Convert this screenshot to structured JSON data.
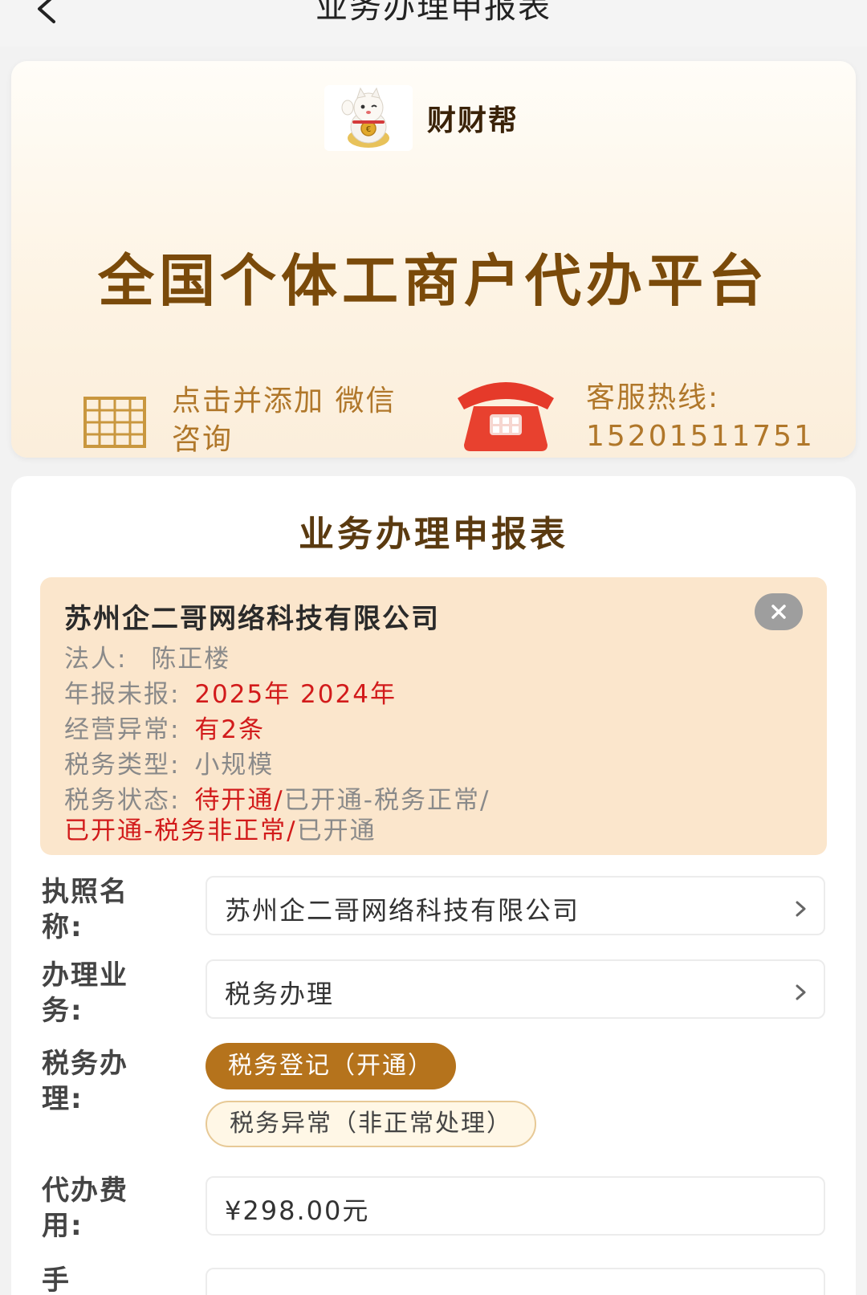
{
  "header": {
    "title": "业务办理申报表"
  },
  "banner": {
    "brand_name": "财财帮",
    "title": "全国个体工商户代办平台",
    "wechat_text": "点击并添加 微信咨询",
    "hotline_label": "客服热线:",
    "hotline_number": "15201511751",
    "carousel_pages": 4,
    "carousel_active_index": 4
  },
  "form": {
    "title": "业务办理申报表",
    "info": {
      "company_name": "苏州企二哥网络科技有限公司",
      "legal_label": "法人:",
      "legal_value": "陈正楼",
      "annual_label": "年报未报:",
      "annual_value": "2025年 2024年",
      "abnormal_label": "经营异常:",
      "abnormal_value": "有2条",
      "tax_type_label": "税务类型:",
      "tax_type_value": "小规模",
      "tax_status_label": "税务状态:",
      "tax_status_1": "待开通/",
      "tax_status_2": "已开通-税务正常/",
      "tax_status_3": "已开通-税务非正常/",
      "tax_status_4": "已开通"
    },
    "license_label": "执照名称:",
    "license_value": "苏州企二哥网络科技有限公司",
    "business_label": "办理业务:",
    "business_value": "税务办理",
    "tax_label": "税务办理:",
    "tax_options": [
      "税务登记（开通）",
      "税务异常（非正常处理）"
    ],
    "tax_selected": "税务登记（开通）",
    "fee_label": "代办费用:",
    "fee_value": "¥298.00元",
    "next_label_partial": "手"
  },
  "colors": {
    "accent": "#b5731c",
    "title_brown": "#7a4a0a",
    "alert_red": "#d21b1b",
    "info_bg": "#fbe6cc"
  },
  "icons": {
    "back": "chevron-left-icon",
    "logo": "lucky-cat-icon",
    "qr": "qr-code-icon",
    "phone": "telephone-icon",
    "close": "close-icon",
    "chevron": "chevron-right-icon"
  }
}
